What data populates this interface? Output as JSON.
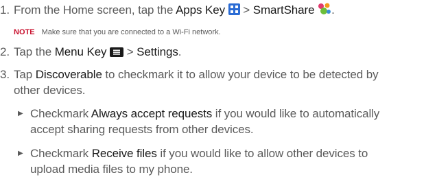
{
  "steps": [
    {
      "number": "1.",
      "prefix": "From the Home screen, tap the ",
      "key1": "Apps Key",
      "sep": " > ",
      "key2": "SmartShare",
      "suffix": "."
    },
    {
      "number": "2.",
      "prefix": "Tap the ",
      "key1": "Menu Key",
      "sep": " > ",
      "key2": "Settings",
      "suffix": "."
    },
    {
      "number": "3.",
      "prefix": "Tap ",
      "key1": "Discoverable",
      "line1_suffix": " to checkmark it to allow your device to be detected by",
      "line2": "other devices."
    }
  ],
  "note": {
    "label": "NOTE",
    "text": "Make sure that you are connected to a Wi-Fi network."
  },
  "bullets": [
    {
      "prefix": "Checkmark ",
      "keyword": "Always accept requests",
      "line1_suffix": " if you would like to automatically",
      "line2": "accept sharing requests from other devices."
    },
    {
      "prefix": "Checkmark ",
      "keyword": "Receive files",
      "line1_suffix": " if you would like to allow other devices to",
      "line2": "upload media files to my phone."
    }
  ],
  "icons": {
    "apps": "apps-grid-icon",
    "smartshare": "smartshare-icon",
    "menu": "menu-key-icon",
    "bullet": "triangle-bullet-icon"
  },
  "colors": {
    "text": "#5a5a5a",
    "keyword": "#1a1a1a",
    "note_label": "#c8102e",
    "apps_icon": "#2b6cd4"
  }
}
